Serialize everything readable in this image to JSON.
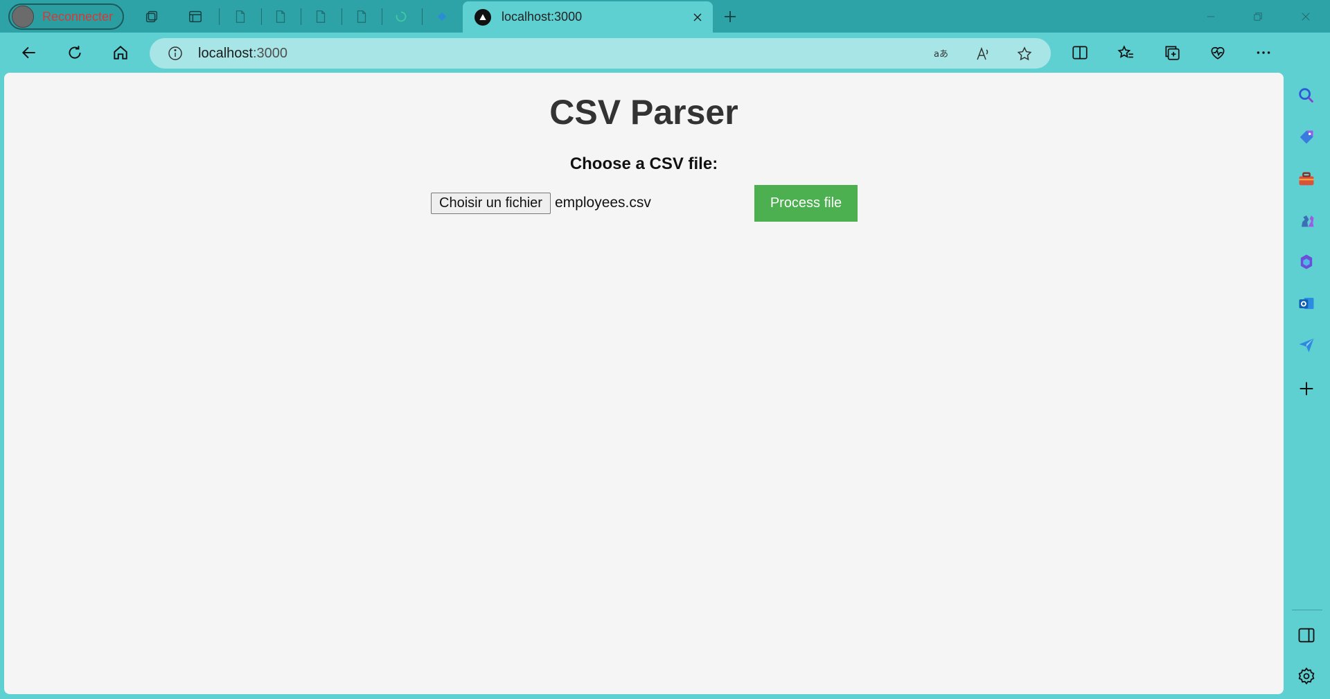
{
  "tabs": {
    "profile_label": "Reconnecter",
    "active_tab_title": "localhost:3000"
  },
  "address_bar": {
    "url_host": "localhost",
    "url_port": ":3000"
  },
  "page": {
    "title": "CSV Parser",
    "file_label": "Choose a CSV file:",
    "choose_button": "Choisir un fichier",
    "file_name": "employees.csv",
    "process_button": "Process file"
  },
  "colors": {
    "tabstrip": "#2ea3a7",
    "toolbar": "#5fd0d2",
    "process_button": "#4caf50"
  },
  "icons": {
    "tab_strip": [
      "workspaces-icon",
      "vertical-tabs-icon",
      "page-icon",
      "page-icon",
      "page-icon",
      "page-icon",
      "loading-icon",
      "diamond-icon"
    ],
    "sidebar": [
      "search-icon",
      "shopping-tag-icon",
      "toolbox-icon",
      "chess-icon",
      "copilot-icon",
      "outlook-icon",
      "send-icon",
      "add-icon",
      "split-panel-icon",
      "settings-icon"
    ]
  }
}
